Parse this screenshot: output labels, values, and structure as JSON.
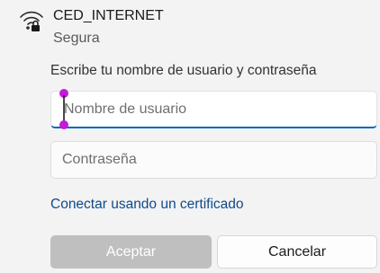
{
  "network": {
    "ssid": "CED_INTERNET",
    "security": "Segura",
    "icon": "wifi-secured-icon"
  },
  "form": {
    "prompt": "Escribe tu nombre de usuario y contraseña",
    "username": {
      "value": "",
      "placeholder": "Nombre de usuario"
    },
    "password": {
      "value": "",
      "placeholder": "Contraseña"
    },
    "cert_link": "Conectar usando un certificado"
  },
  "buttons": {
    "accept": "Aceptar",
    "cancel": "Cancelar"
  },
  "colors": {
    "accent": "#0067c0",
    "link": "#0f4a8a",
    "disabled_button": "#bfbfbf",
    "caret_handle": "#c21bd6"
  }
}
